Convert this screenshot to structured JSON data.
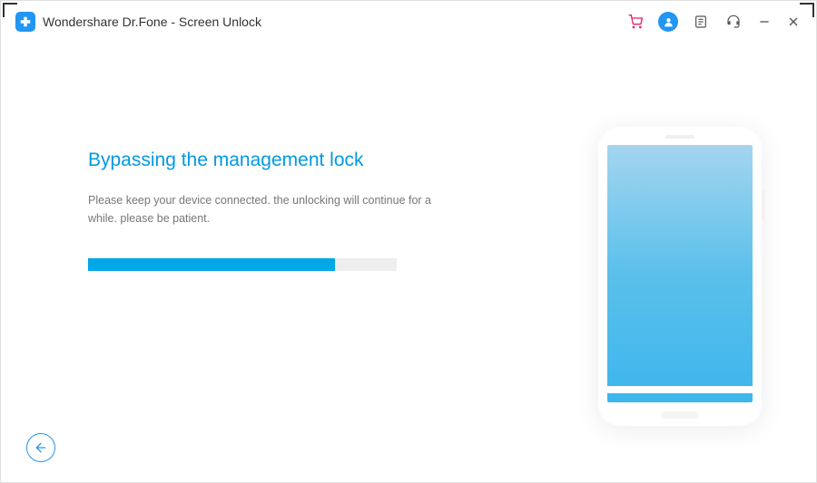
{
  "app": {
    "title": "Wondershare Dr.Fone - Screen Unlock"
  },
  "titlebar": {
    "icons": {
      "cart": "cart-icon",
      "user": "user-icon",
      "feedback": "feedback-icon",
      "support": "headset-icon",
      "minimize": "minimize-icon",
      "close": "close-icon"
    }
  },
  "main": {
    "heading": "Bypassing the management lock",
    "subtext": "Please keep your device connected. the unlocking will continue for a while. please be patient."
  },
  "progress": {
    "percent": 80
  },
  "colors": {
    "accent": "#00a8e8",
    "brand": "#2196F3",
    "text": "#333333",
    "muted": "#777777",
    "cart": "#e91e63"
  },
  "footer": {
    "back_label": "Back"
  }
}
